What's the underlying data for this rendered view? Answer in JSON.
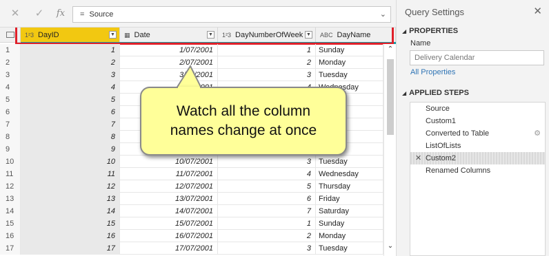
{
  "formula_bar": {
    "cancel_icon": "close-icon",
    "confirm_icon": "check-icon",
    "fx_label": "fx",
    "eq": "=",
    "formula": "Source",
    "expand_icon": "chevron-down-icon"
  },
  "grid": {
    "columns": [
      {
        "type_icon": "1²3",
        "name": "DayID"
      },
      {
        "type_icon": "▦",
        "name": "Date"
      },
      {
        "type_icon": "1²3",
        "name": "DayNumberOfWeek"
      },
      {
        "type_icon": "ABC",
        "name": "DayName"
      }
    ],
    "rows": [
      {
        "n": "1",
        "id": "1",
        "date": "1/07/2001",
        "dnw": "1",
        "name": "Sunday"
      },
      {
        "n": "2",
        "id": "2",
        "date": "2/07/2001",
        "dnw": "2",
        "name": "Monday"
      },
      {
        "n": "3",
        "id": "3",
        "date": "3/07/2001",
        "dnw": "3",
        "name": "Tuesday"
      },
      {
        "n": "4",
        "id": "4",
        "date": "4/07/2001",
        "dnw": "4",
        "name": "Wednesday"
      },
      {
        "n": "5",
        "id": "5",
        "date": "",
        "dnw": "",
        "name": ""
      },
      {
        "n": "6",
        "id": "6",
        "date": "",
        "dnw": "",
        "name": ""
      },
      {
        "n": "7",
        "id": "7",
        "date": "",
        "dnw": "",
        "name": ""
      },
      {
        "n": "8",
        "id": "8",
        "date": "",
        "dnw": "",
        "name": ""
      },
      {
        "n": "9",
        "id": "9",
        "date": "",
        "dnw": "",
        "name": ""
      },
      {
        "n": "10",
        "id": "10",
        "date": "10/07/2001",
        "dnw": "3",
        "name": "Tuesday"
      },
      {
        "n": "11",
        "id": "11",
        "date": "11/07/2001",
        "dnw": "4",
        "name": "Wednesday"
      },
      {
        "n": "12",
        "id": "12",
        "date": "12/07/2001",
        "dnw": "5",
        "name": "Thursday"
      },
      {
        "n": "13",
        "id": "13",
        "date": "13/07/2001",
        "dnw": "6",
        "name": "Friday"
      },
      {
        "n": "14",
        "id": "14",
        "date": "14/07/2001",
        "dnw": "7",
        "name": "Saturday"
      },
      {
        "n": "15",
        "id": "15",
        "date": "15/07/2001",
        "dnw": "1",
        "name": "Sunday"
      },
      {
        "n": "16",
        "id": "16",
        "date": "16/07/2001",
        "dnw": "2",
        "name": "Monday"
      },
      {
        "n": "17",
        "id": "17",
        "date": "17/07/2001",
        "dnw": "3",
        "name": "Tuesday"
      }
    ]
  },
  "callout": {
    "line1": "Watch all the column",
    "line2": "names change at once",
    "color": "#ffff99"
  },
  "query_settings": {
    "title": "Query Settings",
    "properties_heading": "PROPERTIES",
    "name_label": "Name",
    "name_value": "Delivery Calendar",
    "all_properties_link": "All Properties",
    "applied_steps_heading": "APPLIED STEPS",
    "steps": [
      {
        "label": "Source",
        "active": false,
        "gear": false
      },
      {
        "label": "Custom1",
        "active": false,
        "gear": false
      },
      {
        "label": "Converted to Table",
        "active": false,
        "gear": true
      },
      {
        "label": "ListOfLists",
        "active": false,
        "gear": false
      },
      {
        "label": "Custom2",
        "active": true,
        "gear": false
      },
      {
        "label": "Renamed Columns",
        "active": false,
        "gear": false
      }
    ]
  },
  "colors": {
    "selected_column": "#f2c811",
    "highlight_box": "#e0202a",
    "teal_bar": "#1a9ea5",
    "link": "#2f74b5"
  }
}
